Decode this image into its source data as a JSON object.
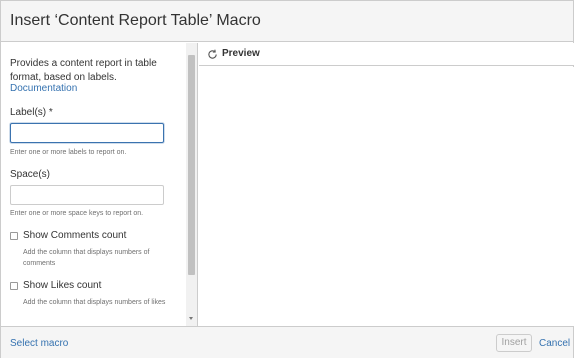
{
  "dialog": {
    "title": "Insert ‘Content Report Table’ Macro"
  },
  "left_panel": {
    "description": "Provides a content report in table format, based on labels.",
    "documentation_link": "Documentation",
    "labels_field": {
      "label": "Label(s) *",
      "value": "",
      "helper": "Enter one or more labels to report on."
    },
    "spaces_field": {
      "label": "Space(s)",
      "value": "",
      "helper": "Enter one or more space keys to report on."
    },
    "show_comments": {
      "label": "Show Comments count",
      "checked": false,
      "helper": "Add the column that displays numbers of comments"
    },
    "show_likes": {
      "label": "Show Likes count",
      "checked": false,
      "helper": "Add the column that displays numbers of likes"
    }
  },
  "preview": {
    "label": "Preview",
    "icon": "refresh-icon"
  },
  "footer": {
    "select_macro": "Select macro",
    "insert_label": "Insert",
    "cancel_label": "Cancel"
  },
  "colors": {
    "link": "#3572b0",
    "focus_border": "#3b73af",
    "header_bg": "#f5f5f5",
    "border": "#cccccc"
  }
}
